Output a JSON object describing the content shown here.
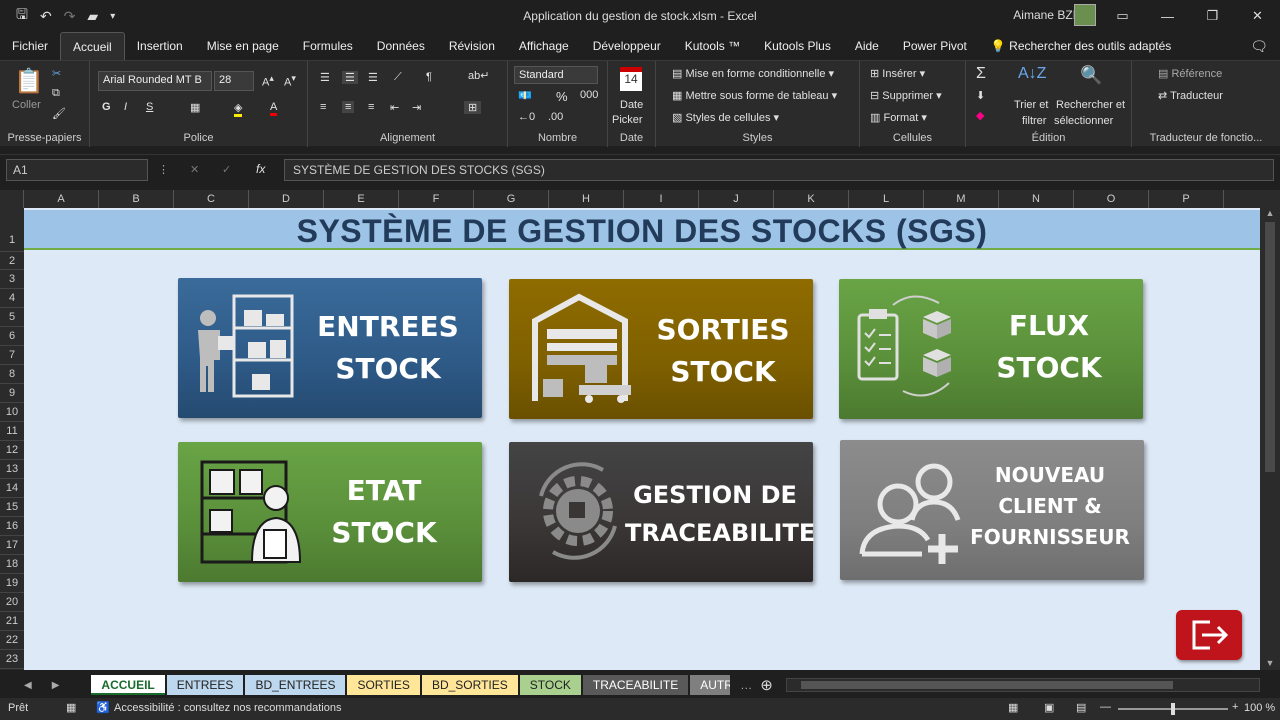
{
  "window": {
    "title": "Application du gestion de stock.xlsm  -  Excel",
    "user": "Aimane BZIOU"
  },
  "menu": [
    "Fichier",
    "Accueil",
    "Insertion",
    "Mise en page",
    "Formules",
    "Données",
    "Révision",
    "Affichage",
    "Développeur",
    "Kutools ™",
    "Kutools Plus",
    "Aide",
    "Power Pivot"
  ],
  "search_tools": "Rechercher des outils adaptés",
  "ribbon": {
    "clipboard": {
      "paste": "Coller",
      "label": "Presse-papiers"
    },
    "font": {
      "name": "Arial Rounded MT B",
      "size": "28",
      "label": "Police",
      "bold": "G",
      "italic": "I",
      "underline": "S"
    },
    "alignment": {
      "label": "Alignement"
    },
    "number": {
      "format": "Standard",
      "label": "Nombre",
      "percent": "%"
    },
    "date": {
      "line1": "Date",
      "line2": "Picker",
      "label": "Date",
      "day": "14"
    },
    "styles": {
      "conditional": "Mise en forme conditionnelle",
      "table": "Mettre sous forme de tableau",
      "cell": "Styles de cellules",
      "label": "Styles"
    },
    "cells": {
      "insert": "Insérer",
      "delete": "Supprimer",
      "format": "Format",
      "label": "Cellules"
    },
    "editing": {
      "sort": "Trier et",
      "sort2": "filtrer",
      "find": "Rechercher et",
      "find2": "sélectionner",
      "label": "Édition"
    },
    "translator": {
      "ref": "Référence",
      "translator": "Traducteur",
      "label": "Traducteur de fonctio..."
    }
  },
  "formula_bar": {
    "cell": "A1",
    "content": "SYSTÈME DE GESTION DES STOCKS (SGS)"
  },
  "columns": [
    "A",
    "B",
    "C",
    "D",
    "E",
    "F",
    "G",
    "H",
    "I",
    "J",
    "K",
    "L",
    "M",
    "N",
    "O",
    "P"
  ],
  "rows": [
    "1",
    "2",
    "3",
    "4",
    "5",
    "6",
    "7",
    "8",
    "9",
    "10",
    "11",
    "12",
    "13",
    "14",
    "15",
    "16",
    "17",
    "18",
    "19",
    "20",
    "21",
    "22",
    "23"
  ],
  "dashboard": {
    "title": "SYSTÈME DE GESTION DES STOCKS (SGS)",
    "tiles": [
      {
        "line1": "ENTREES",
        "line2": "STOCK",
        "color": "#2e5a87"
      },
      {
        "line1": "SORTIES",
        "line2": "STOCK",
        "color": "#7f6000"
      },
      {
        "line1": "FLUX",
        "line2": "STOCK",
        "color": "#5a8f3a"
      },
      {
        "line1": "ETAT",
        "line2": "STOCK",
        "color": "#5a8f3a"
      },
      {
        "line1": "GESTION DE",
        "line2": "TRACEABILITE",
        "color": "#3a3636"
      },
      {
        "line1": "NOUVEAU",
        "line2": "CLIENT &",
        "line3": "FOURNISSEUR",
        "color": "#7f7f7f"
      }
    ]
  },
  "sheet_tabs": [
    {
      "name": "ACCUEIL",
      "color": "#ffffff"
    },
    {
      "name": "ENTREES",
      "color": "#bdd7ee"
    },
    {
      "name": "BD_ENTREES",
      "color": "#bdd7ee"
    },
    {
      "name": "SORTIES",
      "color": "#ffe699"
    },
    {
      "name": "BD_SORTIES",
      "color": "#ffe699"
    },
    {
      "name": "STOCK",
      "color": "#a9d08e"
    },
    {
      "name": "TRACEABILITE",
      "color": "#595959"
    },
    {
      "name": "AUTR",
      "color": "#7f7f7f"
    }
  ],
  "status": {
    "ready": "Prêt",
    "accessibility": "Accessibilité : consultez nos recommandations",
    "zoom": "100 %"
  }
}
